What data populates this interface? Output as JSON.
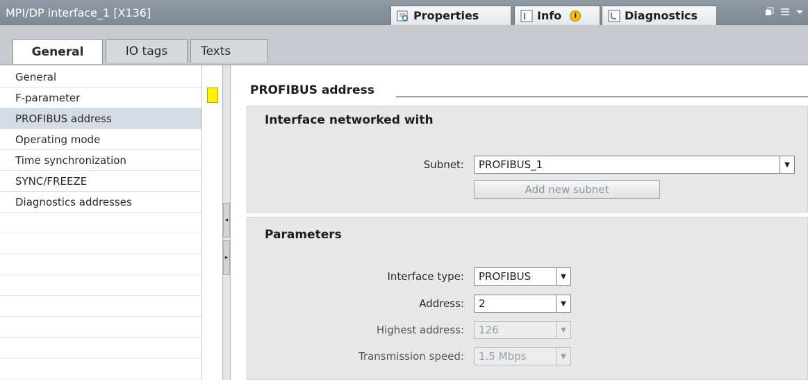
{
  "window": {
    "title": "MPI/DP interface_1 [X136]",
    "tabs": [
      {
        "label": "Properties",
        "icon": "properties-icon"
      },
      {
        "label": "Info",
        "icon": "info-icon"
      },
      {
        "label": "Diagnostics",
        "icon": "diagnostics-icon"
      }
    ],
    "info_badge": "i",
    "controls": [
      "restore-icon",
      "list-icon",
      "chevron-down-icon"
    ]
  },
  "subtabs": [
    "General",
    "IO tags",
    "Texts"
  ],
  "nav": {
    "items": [
      "General",
      "F-parameter",
      "PROFIBUS address",
      "Operating mode",
      "Time synchronization",
      "SYNC/FREEZE",
      "Diagnostics addresses"
    ],
    "selected": "PROFIBUS address"
  },
  "content": {
    "section_title": "PROFIBUS address",
    "networked": {
      "title": "Interface networked with",
      "subnet_label": "Subnet:",
      "subnet_value": "PROFIBUS_1",
      "add_button": "Add new subnet"
    },
    "parameters": {
      "title": "Parameters",
      "interface_type_label": "Interface type:",
      "interface_type_value": "PROFIBUS",
      "address_label": "Address:",
      "address_value": "2",
      "highest_label": "Highest address:",
      "highest_value": "126",
      "speed_label": "Transmission speed:",
      "speed_value": "1.5 Mbps"
    }
  },
  "colors": {
    "titlebar": "#8f9aa4",
    "selected_row": "#d4dbe2",
    "flag": "#fff200",
    "group_bg": "#e7e7e7"
  }
}
